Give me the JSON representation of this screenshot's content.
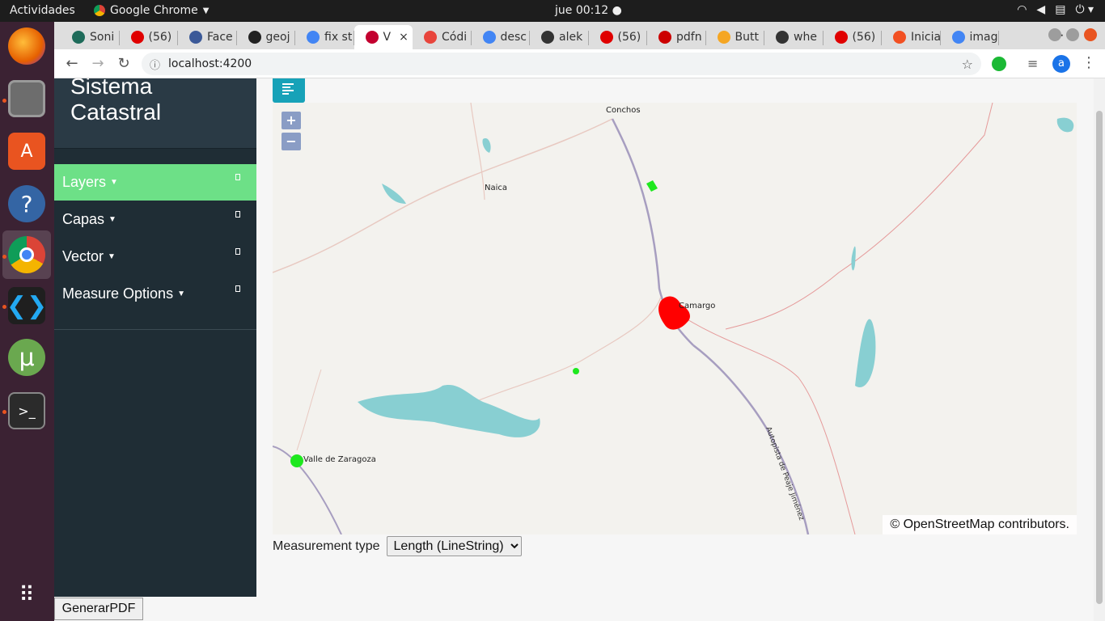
{
  "topbar": {
    "activities": "Actividades",
    "app_name": "Google Chrome",
    "clock": "jue 00:12 ●",
    "tray_icons": [
      "wifi-icon",
      "volume-icon",
      "clipboard-icon",
      "power-icon"
    ]
  },
  "dock": {
    "apps": [
      "firefox",
      "files",
      "software-center",
      "help",
      "chrome",
      "vscode",
      "utorrent",
      "terminal",
      "show-apps"
    ]
  },
  "tabs": [
    {
      "label": "Soni",
      "favicon": "#1e6b5a"
    },
    {
      "label": "(56)",
      "favicon": "#e00000"
    },
    {
      "label": "Face",
      "favicon": "#3b5998"
    },
    {
      "label": "geoj",
      "favicon": "#222222"
    },
    {
      "label": "fix st",
      "favicon": "#4285f4"
    },
    {
      "label": "V",
      "favicon": "#c3002f",
      "active": true
    },
    {
      "label": "Códi",
      "favicon": "#e8453c"
    },
    {
      "label": "desc",
      "favicon": "#4285f4"
    },
    {
      "label": "alek",
      "favicon": "#333333"
    },
    {
      "label": "(56)",
      "favicon": "#e00000"
    },
    {
      "label": "pdfn",
      "favicon": "#cc0000"
    },
    {
      "label": "Butt",
      "favicon": "#f5a623"
    },
    {
      "label": "whe",
      "favicon": "#333333"
    },
    {
      "label": "(56)",
      "favicon": "#e00000"
    },
    {
      "label": "Inicia",
      "favicon": "#f25022"
    },
    {
      "label": "imag",
      "favicon": "#4285f4"
    }
  ],
  "newtab": "+",
  "address": {
    "url": "localhost:4200"
  },
  "profile": {
    "initial": "a"
  },
  "sidebar": {
    "title": "Sistema Catastral",
    "items": [
      {
        "label": "Layers",
        "active": true
      },
      {
        "label": "Capas",
        "active": false
      },
      {
        "label": "Vector",
        "active": false
      },
      {
        "label": "Measure Options",
        "active": false
      }
    ]
  },
  "map": {
    "zoom_in": "+",
    "zoom_out": "−",
    "labels": {
      "conchos": "Conchos",
      "naica": "Naica",
      "camargo": "Camargo",
      "valle": "Valle de Zaragoza",
      "autopista": "Autopista de Peaje Jiménez"
    },
    "attribution": "© OpenStreetMap contributors."
  },
  "measurement": {
    "label": "Measurement type",
    "selected": "Length (LineString)"
  },
  "pdf_button": "GenerarPDF"
}
